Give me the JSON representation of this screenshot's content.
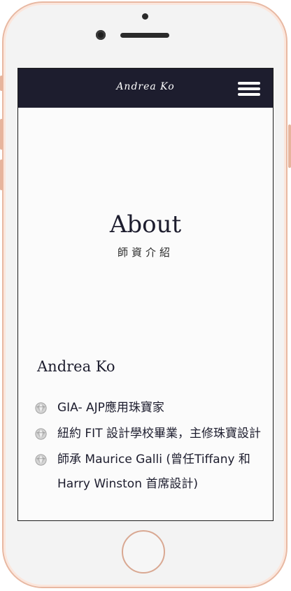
{
  "device": {
    "frame_color": "#e8b8a2"
  },
  "navbar": {
    "logo": "Andrea Ko",
    "menu_icon": "hamburger-menu-icon",
    "background": "#1d1d2e"
  },
  "hero": {
    "title": "About",
    "subtitle": "師資介紹"
  },
  "profile": {
    "name": "Andrea Ko",
    "bullet_icon": "gem-icon",
    "items": [
      {
        "text": "GIA- AJP應用珠寶家"
      },
      {
        "text": "紐約 FIT 設計學校畢業，主修珠寶設計"
      },
      {
        "text": "師承 Maurice Galli (曾任Tiffany 和 Harry Winston 首席設計)"
      }
    ]
  }
}
